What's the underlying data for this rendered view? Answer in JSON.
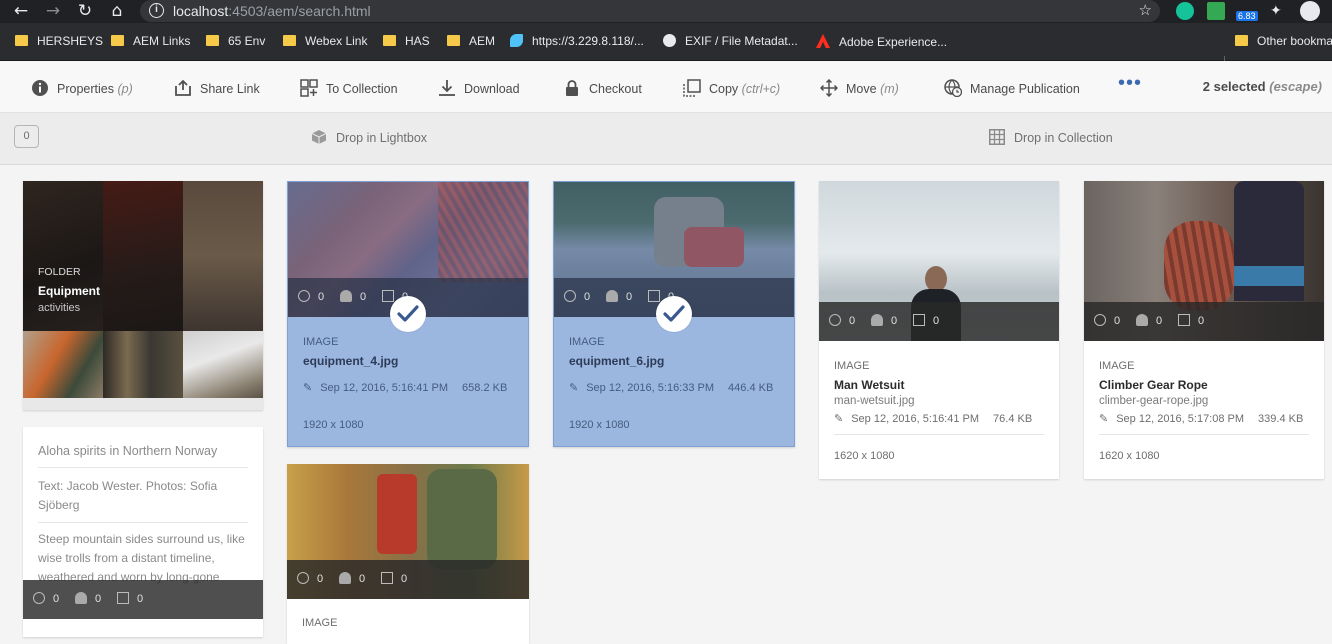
{
  "browser": {
    "url_host": "localhost",
    "url_rest": ":4503/aem/search.html",
    "extension_badge": "6.83",
    "bookmarks": [
      {
        "label": "HERSHEYS",
        "kind": "folder"
      },
      {
        "label": "AEM Links",
        "kind": "folder"
      },
      {
        "label": "65 Env",
        "kind": "folder"
      },
      {
        "label": "Webex Link",
        "kind": "folder"
      },
      {
        "label": "HAS",
        "kind": "folder"
      },
      {
        "label": "AEM",
        "kind": "folder"
      },
      {
        "label": "https://3.229.8.118/...",
        "kind": "site"
      },
      {
        "label": "EXIF / File Metadat...",
        "kind": "globe"
      },
      {
        "label": "Adobe Experience...",
        "kind": "adobe"
      },
      {
        "label": "Other bookmarks",
        "kind": "folder"
      }
    ]
  },
  "toolbar": {
    "properties": "Properties",
    "properties_key": "(p)",
    "share_link": "Share Link",
    "to_collection": "To Collection",
    "download": "Download",
    "checkout": "Checkout",
    "copy": "Copy",
    "copy_key": "(ctrl+c)",
    "move": "Move",
    "move_key": "(m)",
    "manage_publication": "Manage Publication",
    "more": "•••",
    "selected": "2 selected",
    "selected_key": "(escape)"
  },
  "dropbar": {
    "count": "0",
    "lightbox": "Drop in Lightbox",
    "collection": "Drop in Collection"
  },
  "folder_card": {
    "type": "FOLDER",
    "title": "Equipment",
    "subtitle": "activities"
  },
  "article_card": {
    "title": "Aloha spirits in Northern Norway",
    "byline": "Text: Jacob Wester. Photos: Sofia Sjöberg",
    "body": "Steep mountain sides surround us, like wise trolls from a distant timeline, weathered and worn by long-gone",
    "stats": [
      "0",
      "0",
      "0"
    ]
  },
  "assets": [
    {
      "type": "IMAGE",
      "title": "equipment_4.jpg",
      "date": "Sep 12, 2016, 5:16:41 PM",
      "size": "658.2 KB",
      "dims": "1920 x 1080",
      "stats": [
        "0",
        "0",
        "0"
      ]
    },
    {
      "type": "IMAGE",
      "title": "equipment_6.jpg",
      "date": "Sep 12, 2016, 5:16:33 PM",
      "size": "446.4 KB",
      "dims": "1920 x 1080",
      "stats": [
        "0",
        "0",
        "0"
      ]
    },
    {
      "type": "IMAGE",
      "title": "Man Wetsuit",
      "file": "man-wetsuit.jpg",
      "date": "Sep 12, 2016, 5:16:41 PM",
      "size": "76.4 KB",
      "dims": "1620 x 1080",
      "stats": [
        "0",
        "0",
        "0"
      ]
    },
    {
      "type": "IMAGE",
      "title": "Climber Gear Rope",
      "file": "climber-gear-rope.jpg",
      "date": "Sep 12, 2016, 5:17:08 PM",
      "size": "339.4 KB",
      "dims": "1620 x 1080",
      "stats": [
        "0",
        "0",
        "0"
      ]
    },
    {
      "type": "IMAGE",
      "stats": [
        "0",
        "0",
        "0"
      ]
    }
  ]
}
